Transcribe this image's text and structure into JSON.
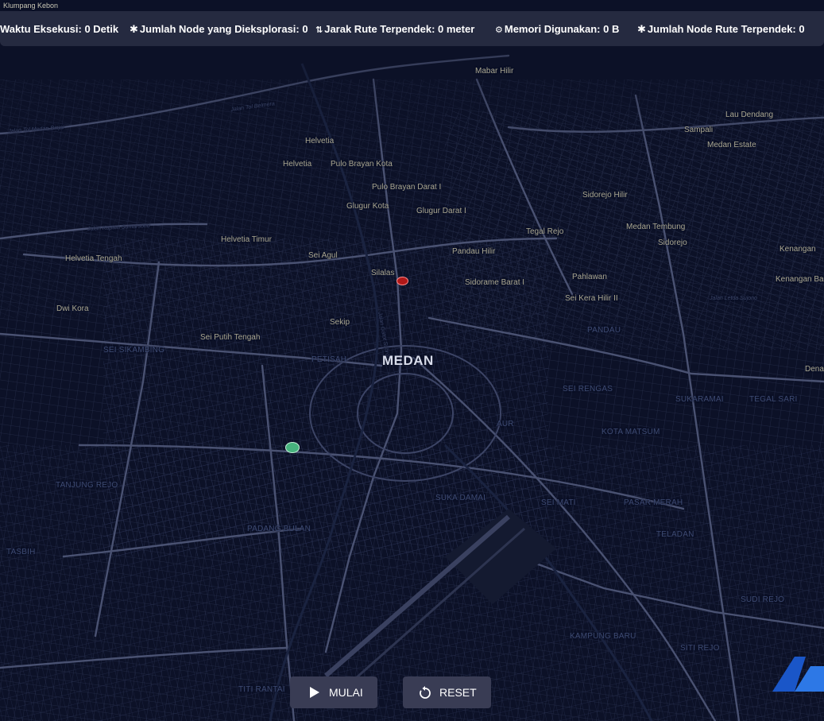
{
  "stats": {
    "execution_time": "Waktu Eksekusi: 0 Detik",
    "nodes_explored": "Jumlah Node yang Dieksplorasi: 0",
    "shortest_distance": "Jarak Rute Terpendek: 0 meter",
    "memory_used": "Memori Digunakan: 0 B",
    "shortest_route_nodes": "Jumlah Node Rute Terpendek: 0"
  },
  "icons": {
    "nodes_explored": "asterisk-icon",
    "shortest_distance": "route-icon",
    "memory_used": "gear-icon",
    "shortest_route_nodes": "asterisk-icon"
  },
  "map": {
    "city": "MEDAN",
    "places": [
      "Klumpang Kebon",
      "Mabar Hilir",
      "Lau Dendang",
      "Sampali",
      "Medan Estate",
      "Helvetia",
      "Helvetia",
      "Pulo Brayan Kota",
      "Pulo Brayan Darat I",
      "Glugur Kota",
      "Glugur Darat I",
      "Sidorejo Hilir",
      "Tegal Rejo",
      "Medan Tembung",
      "Sidorejo",
      "Helvetia Timur",
      "Helvetia Tengah",
      "Sei Agul",
      "Pandau Hilir",
      "Kenangan",
      "Silalas",
      "Pahlawan",
      "Sidorame Barat I",
      "Kenangan Ba",
      "Sei Kera Hilir II",
      "Dwi Kora",
      "Sekip",
      "Sei Putih Tengah",
      "Dena"
    ],
    "districts": [
      "PANDAU",
      "SEI SIKAMBING",
      "PETISAH",
      "SEI RENGAS",
      "SUKARAMAI",
      "TEGAL SARI",
      "AUR",
      "KOTA MATSUM",
      "TANJUNG REJO",
      "SUKA DAMAI",
      "SEI MATI",
      "PASAR MERAH",
      "PADANG BULAN",
      "TELADAN",
      "TASBIH",
      "SUDI REJO",
      "KAMPUNG BARU",
      "SITI REJO",
      "TITI RANTAI"
    ],
    "roads": [
      "Jalan Tol Medan-Binjai",
      "Jalan Tol Belmera",
      "Jalan Kapten Sumarsono",
      "Jalan Letda Sujono",
      "Jalan Gatot Subroto"
    ],
    "colors": {
      "background": "#0c1127",
      "road_minor": "#2b3352",
      "road_major": "#4a5272",
      "start_marker": "#47b37e",
      "end_marker": "#b01818"
    }
  },
  "controls": {
    "start_label": "MULAI",
    "reset_label": "RESET",
    "start_icon": "play-icon",
    "reset_icon": "reset-icon"
  }
}
